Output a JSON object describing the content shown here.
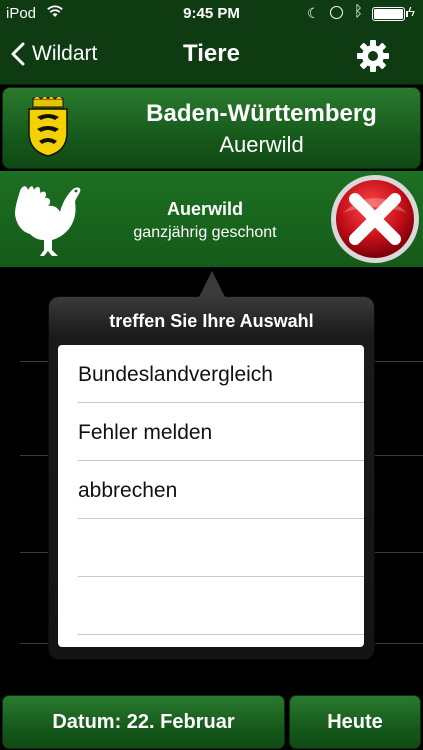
{
  "status_bar": {
    "carrier": "iPod",
    "time": "9:45 PM",
    "battery_level": 0.95
  },
  "nav": {
    "back_label": "Wildart",
    "title": "Tiere"
  },
  "region": {
    "state": "Baden-Württemberg",
    "species": "Auerwild"
  },
  "animal": {
    "name": "Auerwild",
    "status": "ganzjährig geschont"
  },
  "popover": {
    "title": "treffen Sie Ihre Auswahl",
    "options": [
      "Bundeslandvergleich",
      "Fehler melden",
      "abbrechen",
      "",
      ""
    ]
  },
  "bottom": {
    "date_label": "Datum: 22. Februar",
    "today_label": "Heute"
  },
  "colors": {
    "nav": "#0f3b12",
    "panel": "#165a1b",
    "close": "#c8101a"
  }
}
